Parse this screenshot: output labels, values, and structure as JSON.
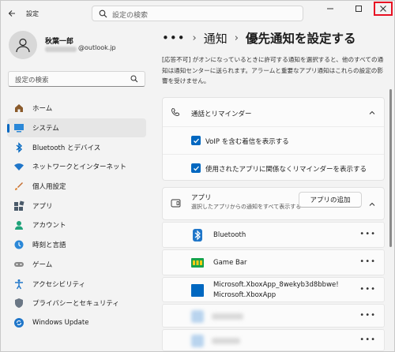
{
  "app": {
    "title": "設定",
    "search_placeholder": "設定の検索"
  },
  "user": {
    "name": "秋葉一郎",
    "email_suffix": "@outlook.jp"
  },
  "sidebar": {
    "search_placeholder": "設定の検索",
    "items": [
      {
        "label": "ホーム",
        "icon": "home-icon"
      },
      {
        "label": "システム",
        "icon": "system-icon",
        "active": true
      },
      {
        "label": "Bluetooth とデバイス",
        "icon": "bluetooth-icon"
      },
      {
        "label": "ネットワークとインターネット",
        "icon": "wifi-icon"
      },
      {
        "label": "個人用設定",
        "icon": "brush-icon"
      },
      {
        "label": "アプリ",
        "icon": "apps-icon"
      },
      {
        "label": "アカウント",
        "icon": "account-icon"
      },
      {
        "label": "時刻と言語",
        "icon": "globe-clock-icon"
      },
      {
        "label": "ゲーム",
        "icon": "gamepad-icon"
      },
      {
        "label": "アクセシビリティ",
        "icon": "accessibility-icon"
      },
      {
        "label": "プライバシーとセキュリティ",
        "icon": "shield-icon"
      },
      {
        "label": "Windows Update",
        "icon": "update-icon"
      }
    ]
  },
  "breadcrumb": {
    "dots": "•••",
    "parent": "通知",
    "current": "優先通知を設定する"
  },
  "description": "[応答不可] がオンになっているときに許可する通知を選択すると、他のすべての通知は通知センターに送られます。アラームと重要なアプリ通知はこれらの設定の影響を受けません。",
  "calls_section": {
    "title": "通話とリマインダー",
    "options": [
      {
        "label": "VoIP を含む着信を表示する",
        "checked": true
      },
      {
        "label": "使用されたアプリに関係なくリマインダーを表示する",
        "checked": true
      }
    ]
  },
  "apps_section": {
    "title": "アプリ",
    "subtitle": "選択したアプリからの通知をすべて表示する",
    "add_button": "アプリの追加",
    "apps": [
      {
        "name": "Bluetooth",
        "icon": "bluetooth-icon"
      },
      {
        "name": "Game Bar",
        "icon": "game-bar-icon"
      },
      {
        "name_line1": "Microsoft.XboxApp_8wekyb3d8bbwe!",
        "name_line2": "Microsoft.XboxApp",
        "icon": "xbox-app-icon"
      }
    ],
    "more_label": "•••"
  },
  "colors": {
    "accent": "#0067c0",
    "close_highlight": "#e81123"
  }
}
